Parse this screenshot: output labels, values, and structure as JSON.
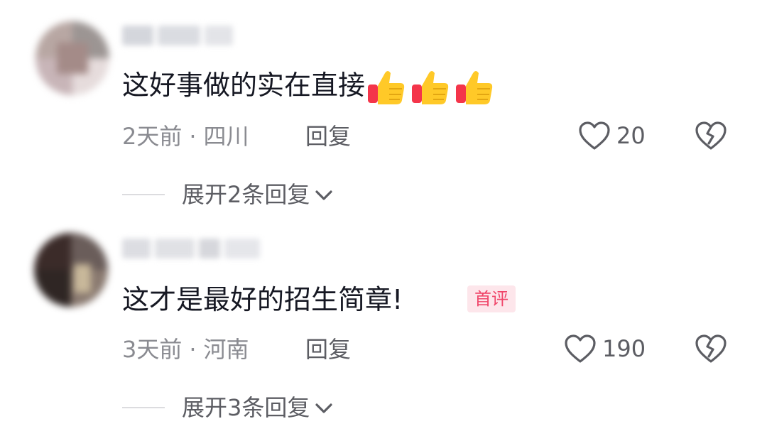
{
  "comments": [
    {
      "text": "这好事做的实在直接",
      "emoji": [
        "thumbs-up",
        "thumbs-up",
        "thumbs-up"
      ],
      "time": "2天前",
      "separator": "·",
      "location": "四川",
      "reply_label": "回复",
      "like_count": "20",
      "expand_label": "展开2条回复",
      "badge": ""
    },
    {
      "text": "这才是最好的招生简章!",
      "time": "3天前",
      "separator": "·",
      "location": "河南",
      "reply_label": "回复",
      "like_count": "190",
      "expand_label": "展开3条回复",
      "badge": "首评"
    }
  ],
  "icons": {
    "like": "heart-outline-icon",
    "dislike": "broken-heart-icon",
    "expand": "chevron-down-icon",
    "emoji": "thumbs-up-icon"
  },
  "colors": {
    "text_primary": "#161823",
    "text_secondary": "#8a8b91",
    "action": "#5c5d63",
    "badge_bg": "#fde6eb",
    "badge_text": "#f0466a",
    "thumb_yellow": "#ffc928",
    "thumb_red": "#f4354a"
  }
}
